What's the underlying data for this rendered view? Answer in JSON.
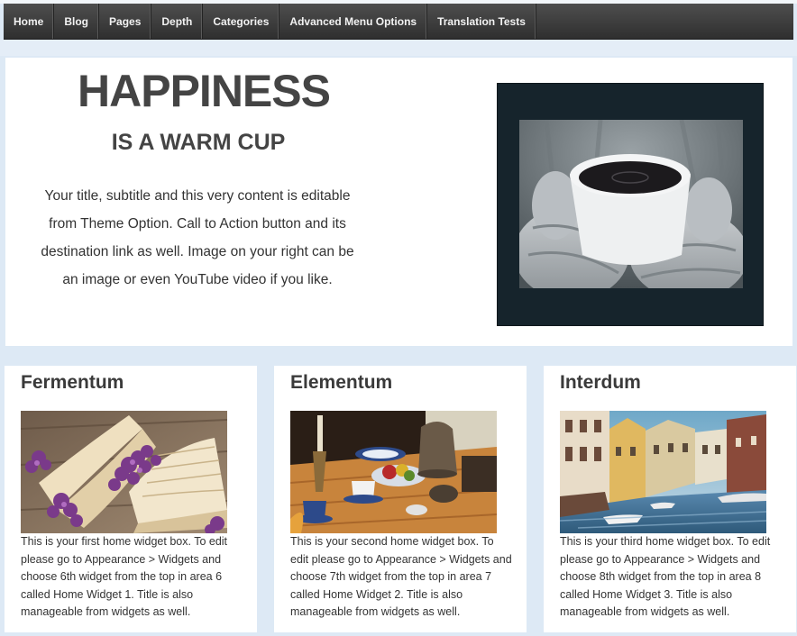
{
  "nav": {
    "items": [
      {
        "label": "Home"
      },
      {
        "label": "Blog"
      },
      {
        "label": "Pages"
      },
      {
        "label": "Depth"
      },
      {
        "label": "Categories"
      },
      {
        "label": "Advanced Menu Options"
      },
      {
        "label": "Translation Tests"
      }
    ]
  },
  "hero": {
    "title": "HAPPINESS",
    "subtitle": "IS A WARM CUP",
    "content": "Your title, subtitle and this very content is editable from Theme Option. Call to Action button and its destination link as well. Image on your right can be an image or even YouTube video if you like.",
    "image": "coffee-cup-in-knitted-mittens-photo"
  },
  "widgets": [
    {
      "title": "Fermentum",
      "image": "open-book-with-lilac-flowers-photo",
      "text": "This is your first home widget box. To edit please go to Appearance > Widgets and choose 6th widget from the top in area 6 called Home Widget 1. Title is also manageable from widgets as well."
    },
    {
      "title": "Elementum",
      "image": "breakfast-table-still-life-photo",
      "text": "This is your second home widget box. To edit please go to Appearance > Widgets and choose 7th widget from the top in area 7 called Home Widget 2. Title is also manageable from widgets as well."
    },
    {
      "title": "Interdum",
      "image": "canal-town-boats-photo",
      "text": "This is your third home widget box. To edit please go to Appearance > Widgets and choose 8th widget from the top in area 8 called Home Widget 3. Title is also manageable from widgets as well."
    }
  ],
  "colors": {
    "navbar": "#3a3a3a",
    "page_background": "#dde9f5",
    "heading": "#444444",
    "hero_frame": "#16242c"
  }
}
